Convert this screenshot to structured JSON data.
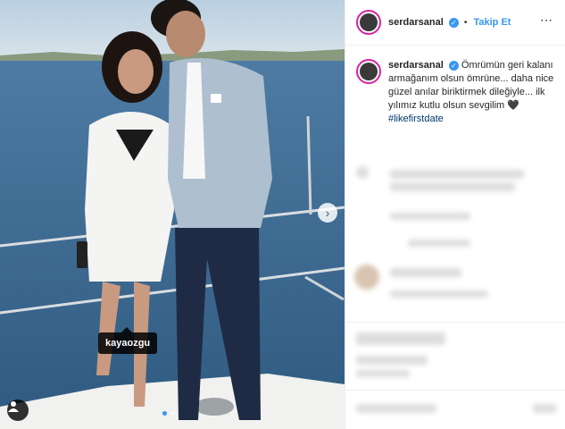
{
  "post": {
    "username": "serdarsanal",
    "follow_label": "Takip Et",
    "follow_separator": "•",
    "caption": "Ömrümün geri kalanı armağanım olsun ömrüne... daha nice güzel anılar biriktirmek dileğiyle... ilk yılımız kutlu olsun sevgilim 🖤",
    "hashtag": "#likefirstdate",
    "tagged_user": "kayaozgu"
  },
  "icons": {
    "verified": "verified-badge-icon",
    "more": "more-options-icon",
    "next": "chevron-right-icon",
    "user": "user-tag-icon"
  },
  "colors": {
    "accent": "#3897f0",
    "hashtag": "#00376b",
    "sea": "#3d6a92"
  }
}
